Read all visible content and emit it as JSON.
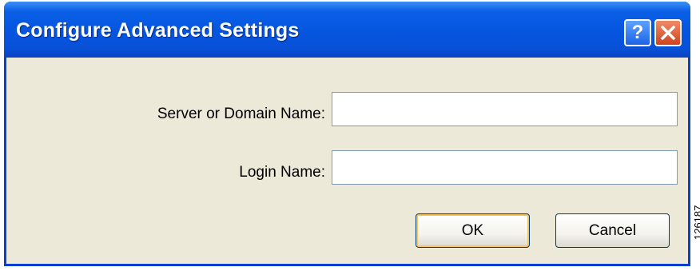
{
  "window": {
    "title": "Configure Advanced Settings",
    "help_label": "?"
  },
  "form": {
    "server_label": "Server or Domain Name:",
    "server_value": "",
    "login_label": "Login Name:",
    "login_value": ""
  },
  "buttons": {
    "ok_label": "OK",
    "cancel_label": "Cancel"
  },
  "figure_id": "126187",
  "icons": {
    "help": "help-icon",
    "close": "close-icon"
  },
  "colors": {
    "titlebar": "#0656e0",
    "dialog_bg": "#ece9d8",
    "close_button": "#d2431e",
    "field_border": "#7f9db9"
  }
}
